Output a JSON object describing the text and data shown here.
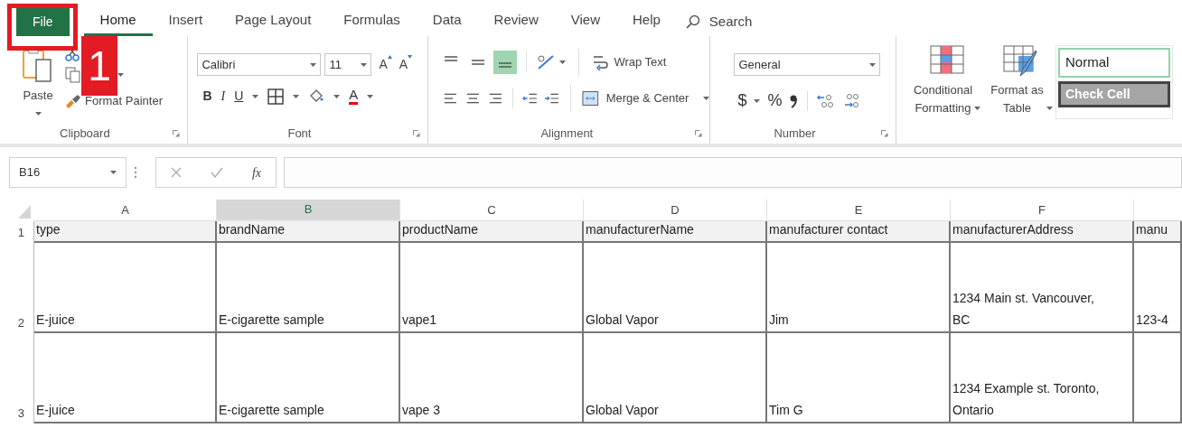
{
  "tabs": [
    {
      "label": "File",
      "kind": "file"
    },
    {
      "label": "Home",
      "kind": "tab",
      "selected": true
    },
    {
      "label": "Insert",
      "kind": "tab",
      "selected": false
    },
    {
      "label": "Page Layout",
      "kind": "tab",
      "selected": false
    },
    {
      "label": "Formulas",
      "kind": "tab",
      "selected": false
    },
    {
      "label": "Data",
      "kind": "tab",
      "selected": false
    },
    {
      "label": "Review",
      "kind": "tab",
      "selected": false
    },
    {
      "label": "View",
      "kind": "tab",
      "selected": false
    },
    {
      "label": "Help",
      "kind": "tab",
      "selected": false
    }
  ],
  "search": {
    "label": "Search"
  },
  "callout": {
    "number": "1"
  },
  "ribbon": {
    "clipboard": {
      "paste": "Paste",
      "format_painter": "Format Painter",
      "group": "Clipboard"
    },
    "font": {
      "font_name": "Calibri",
      "font_size": "11",
      "grow": "A",
      "shrink": "A",
      "style_buttons": [
        "B",
        "I",
        "U"
      ],
      "font_color": "A",
      "group": "Font"
    },
    "alignment": {
      "vertical_align": [
        {
          "selected": false
        },
        {
          "selected": false
        },
        {
          "selected": true
        }
      ],
      "wrap_text": "Wrap Text",
      "merge": "Merge & Center",
      "group": "Alignment"
    },
    "number": {
      "format": "General",
      "currency": "$",
      "percent": "%",
      "group": "Number"
    },
    "styles": {
      "conditional": "Conditional Formatting",
      "format_table": "Format as Table",
      "cell_styles": [
        {
          "label": "Normal",
          "kind": "normal"
        },
        {
          "label": "Check Cell",
          "kind": "check"
        }
      ]
    }
  },
  "formula_bar": {
    "name_box": "B16",
    "fx": "fx"
  },
  "sheet": {
    "columns": [
      {
        "letter": "A",
        "selected": false
      },
      {
        "letter": "B",
        "selected": true
      },
      {
        "letter": "C",
        "selected": false
      },
      {
        "letter": "D",
        "selected": false
      },
      {
        "letter": "E",
        "selected": false
      },
      {
        "letter": "F",
        "selected": false
      }
    ],
    "rows": [
      {
        "number": "1",
        "cells": [
          "type",
          "brandName",
          "productName",
          "manufacturerName",
          "manufacturer contact",
          "manufacturerAddress",
          "manu"
        ]
      },
      {
        "number": "2",
        "cells": [
          "E-juice",
          "E-cigarette sample",
          "vape1",
          "Global Vapor",
          "Jim",
          "1234 Main st. Vancouver,\nBC",
          "123-4"
        ]
      },
      {
        "number": "3",
        "cells": [
          "E-juice",
          "E-cigarette sample",
          "vape 3",
          "Global Vapor",
          "Tim G",
          "1234 Example st. Toronto,\nOntario",
          ""
        ]
      }
    ]
  }
}
